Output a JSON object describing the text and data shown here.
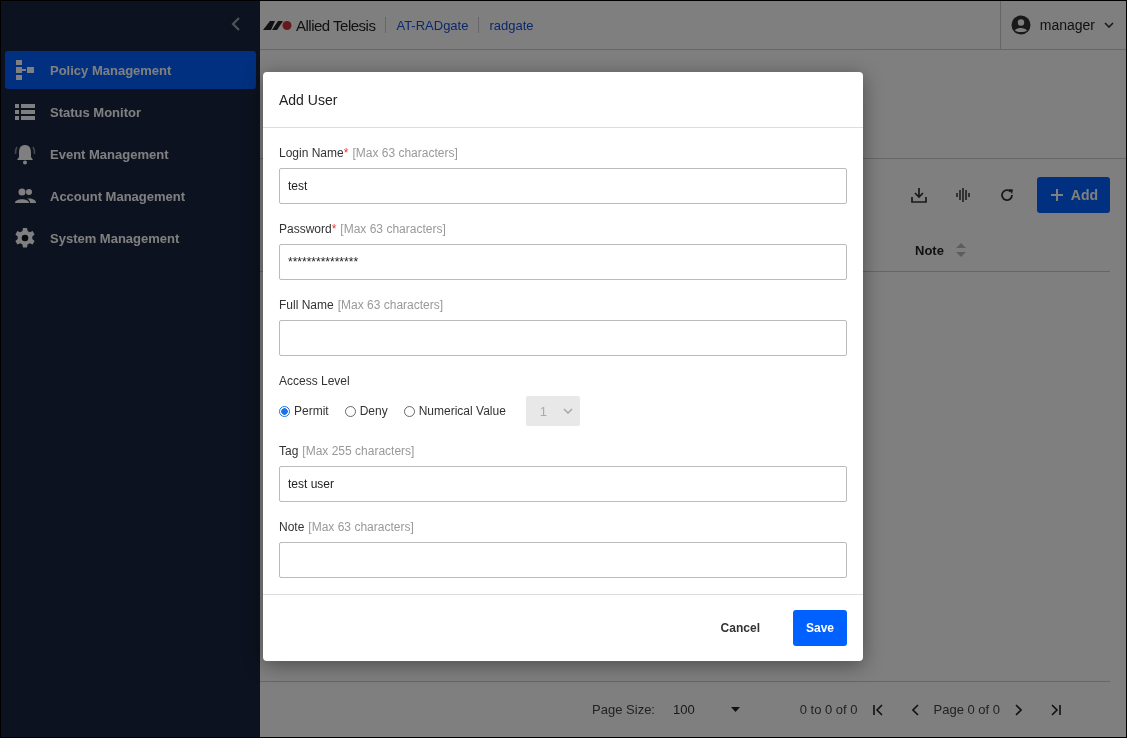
{
  "sidebar": {
    "items": [
      {
        "label": "Policy Management",
        "selected": true
      },
      {
        "label": "Status Monitor",
        "selected": false
      },
      {
        "label": "Event Management",
        "selected": false
      },
      {
        "label": "Account Management",
        "selected": false
      },
      {
        "label": "System Management",
        "selected": false
      }
    ]
  },
  "header": {
    "brand": "Allied Telesis",
    "breadcrumbs": [
      "AT-RADgate",
      "radgate"
    ],
    "user": "manager"
  },
  "toolbar": {
    "add_button": "Add"
  },
  "table": {
    "columns": [
      {
        "label": "Note"
      }
    ]
  },
  "pagination": {
    "page_size_label": "Page Size:",
    "page_size": "100",
    "range": "0 to 0 of 0",
    "page": "Page 0 of 0"
  },
  "dialog": {
    "title": "Add User",
    "fields": [
      {
        "kind": "text",
        "label": "Login Name",
        "required_mark": "*",
        "hint": "[Max 63 characters]",
        "value": "test"
      },
      {
        "kind": "text",
        "label": "Password",
        "required_mark": "*",
        "hint": "[Max 63 characters]",
        "value": "***************"
      },
      {
        "kind": "text",
        "label": "Full Name",
        "hint": "[Max 63 characters]"
      },
      {
        "kind": "radio",
        "label": "Access Level",
        "options": [
          {
            "label": "Permit",
            "selected": true
          },
          {
            "label": "Deny",
            "selected": false
          },
          {
            "label": "Numerical Value",
            "selected": false
          }
        ],
        "select": {
          "value": "1",
          "disabled": true
        }
      },
      {
        "kind": "text",
        "label": "Tag",
        "hint": "[Max 255 characters]",
        "value": "test user"
      },
      {
        "kind": "text",
        "label": "Note",
        "hint": "[Max 63 characters]"
      }
    ],
    "buttons": [
      {
        "label": "Cancel",
        "kind": "secondary"
      },
      {
        "label": "Save",
        "kind": "primary"
      }
    ]
  }
}
